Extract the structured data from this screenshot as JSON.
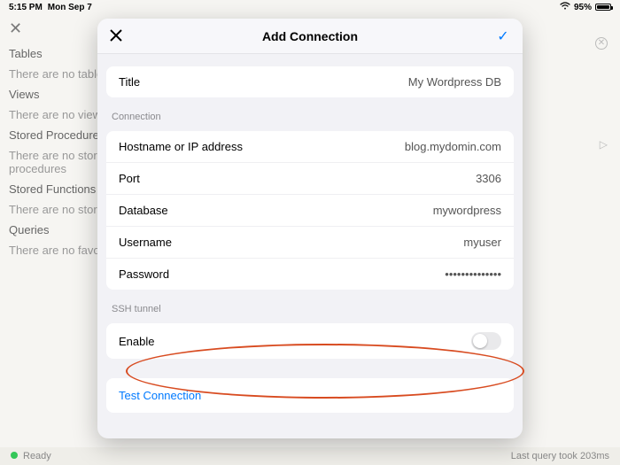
{
  "status": {
    "time": "5:15 PM",
    "date": "Mon Sep 7",
    "battery": "95%"
  },
  "sidebar": {
    "sections": [
      {
        "title": "Tables",
        "empty": "There are no tables"
      },
      {
        "title": "Views",
        "empty": "There are no views"
      },
      {
        "title": "Stored Procedures",
        "empty": "There are no stored procedures"
      },
      {
        "title": "Stored Functions",
        "empty": "There are no stored functions"
      },
      {
        "title": "Queries",
        "empty": "There are no favorites"
      }
    ]
  },
  "footer": {
    "status": "Ready",
    "right": "Last query took 203ms"
  },
  "modal": {
    "title": "Add Connection",
    "titleField": {
      "label": "Title",
      "value": "My Wordpress DB"
    },
    "connection": {
      "heading": "Connection",
      "hostname": {
        "label": "Hostname or IP address",
        "value": "blog.mydomin.com"
      },
      "port": {
        "label": "Port",
        "value": "3306"
      },
      "database": {
        "label": "Database",
        "value": "mywordpress"
      },
      "username": {
        "label": "Username",
        "value": "myuser"
      },
      "password": {
        "label": "Password",
        "value": "••••••••••••••"
      }
    },
    "ssh": {
      "heading": "SSH tunnel",
      "enable": "Enable"
    },
    "test": "Test Connection"
  }
}
